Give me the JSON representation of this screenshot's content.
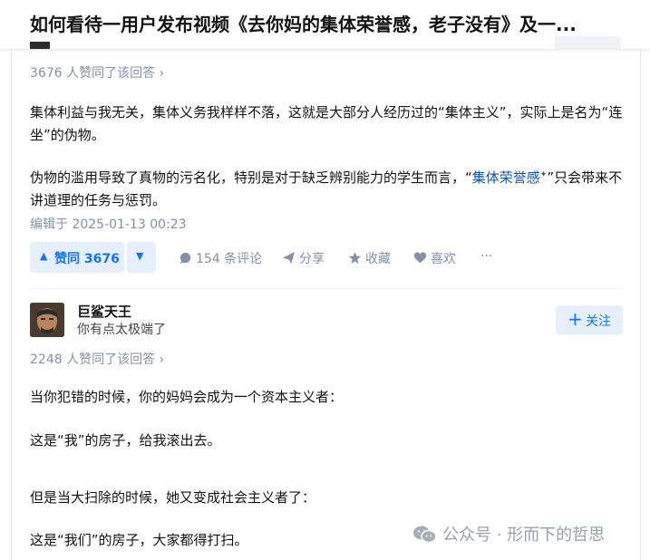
{
  "question": {
    "title": "如何看待一用户发布视频《去你妈的集体荣誉感，老子没有》及一..."
  },
  "answer1": {
    "voters": "3676 人赞同了该回答 ›",
    "para1": "集体利益与我无关，集体义务我样样不落，这就是大部分人经历过的“集体主义”，实际上是名为“连坐”的伪物。",
    "para2_pre": "伪物的滥用导致了真物的污名化，特别是对于缺乏辨别能力的学生而言，“",
    "para2_link": "集体荣誉感",
    "para2_link_sup": "✦",
    "para2_post": "”只会带来不讲道理的任务与惩罚。",
    "edit_time": "编辑于 2025-01-13 00:23",
    "actions": {
      "vote_icon": "▲",
      "vote_label": "赞同 3676",
      "downvote_icon": "▼",
      "comment": "154 条评论",
      "share": "分享",
      "favorite": "收藏",
      "like": "喜欢",
      "more": "···"
    }
  },
  "answer2": {
    "author": {
      "name": "巨鲨天王",
      "bio": "你有点太极端了"
    },
    "follow_label": "关注",
    "follow_icon": "+",
    "voters": "2248 人赞同了该回答 ›",
    "lines": [
      "当你犯错的时候，你的妈妈会成为一个资本主义者：",
      "这是“我”的房子，给我滚出去。",
      "但是当大扫除的时候，她又变成社会主义者了：",
      "这是“我们”的房子，大家都得打扫。"
    ]
  },
  "watermark": {
    "text": "公众号 · 形而下的哲思"
  },
  "colors": {
    "accent": "#1772f6",
    "accent_bg": "#e5effe",
    "muted": "#8590a6",
    "link": "#175199"
  }
}
